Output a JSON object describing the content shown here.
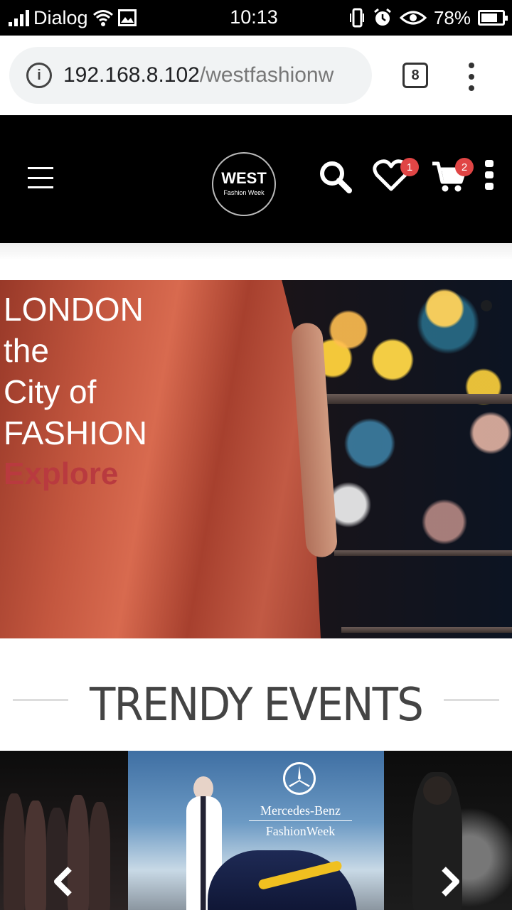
{
  "status_bar": {
    "carrier": "Dialog",
    "time": "10:13",
    "battery": "78%",
    "icons": [
      "signal-icon",
      "wifi-icon",
      "image-icon",
      "vibrate-icon",
      "alarm-icon",
      "eye-icon",
      "battery-icon"
    ]
  },
  "browser": {
    "url_host": "192.168.8.102",
    "url_path": "/westfashionw",
    "tab_count": "8"
  },
  "site_header": {
    "logo_line1": "WEST",
    "logo_line2": "Fashion Week",
    "wishlist_count": "1",
    "cart_count": "2",
    "colors": {
      "background": "#000000",
      "badge": "#e04545"
    }
  },
  "hero": {
    "lines": [
      "LONDON",
      "the",
      "City of",
      "FASHION"
    ],
    "cta": "Explore",
    "cta_color": "#b93a3f"
  },
  "trendy": {
    "title": "TRENDY EVENTS"
  },
  "carousel": {
    "center_slide": {
      "brand_line1": "Mercedes-Benz",
      "brand_line2": "FashionWeek"
    },
    "icons": [
      "chevron-left-icon",
      "chevron-right-icon"
    ]
  }
}
